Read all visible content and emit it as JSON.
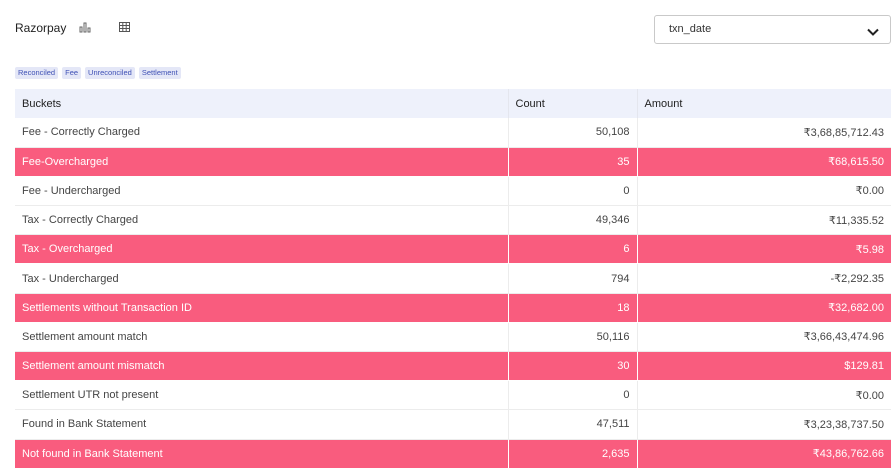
{
  "header": {
    "title": "Razorpay",
    "chart_icon": "bar-chart-icon",
    "table_icon": "table-grid-icon"
  },
  "date_select": {
    "value": "txn_date",
    "icon": "chevron-down-icon"
  },
  "tags": [
    "Reconciled",
    "Fee",
    "Unreconciled",
    "Settlement"
  ],
  "table": {
    "headers": {
      "buckets": "Buckets",
      "count": "Count",
      "amount": "Amount"
    },
    "rows": [
      {
        "bucket": "Fee - Correctly Charged",
        "count": "50,108",
        "amount": "₹3,68,85,712.43",
        "highlight": false
      },
      {
        "bucket": "Fee-Overcharged",
        "count": "35",
        "amount": "₹68,615.50",
        "highlight": true
      },
      {
        "bucket": "Fee - Undercharged",
        "count": "0",
        "amount": "₹0.00",
        "highlight": false
      },
      {
        "bucket": "Tax - Correctly Charged",
        "count": "49,346",
        "amount": "₹11,335.52",
        "highlight": false
      },
      {
        "bucket": "Tax - Overcharged",
        "count": "6",
        "amount": "₹5.98",
        "highlight": true
      },
      {
        "bucket": "Tax - Undercharged",
        "count": "794",
        "amount": "-₹2,292.35",
        "highlight": false
      },
      {
        "bucket": "Settlements without Transaction ID",
        "count": "18",
        "amount": "₹32,682.00",
        "highlight": true
      },
      {
        "bucket": "Settlement amount match",
        "count": "50,116",
        "amount": "₹3,66,43,474.96",
        "highlight": false
      },
      {
        "bucket": "Settlement amount mismatch",
        "count": "30",
        "amount": "$129.81",
        "highlight": true
      },
      {
        "bucket": "Settlement UTR not present",
        "count": "0",
        "amount": "₹0.00",
        "highlight": false
      },
      {
        "bucket": "Found in Bank Statement",
        "count": "47,511",
        "amount": "₹3,23,38,737.50",
        "highlight": false
      },
      {
        "bucket": "Not found in Bank Statement",
        "count": "2,635",
        "amount": "₹43,86,762.66",
        "highlight": true
      }
    ]
  },
  "colors": {
    "highlight_row": "#f95c7e",
    "header_bg": "#eef1fb",
    "tag_bg": "#e4e7f7",
    "tag_text": "#3f51b5"
  }
}
